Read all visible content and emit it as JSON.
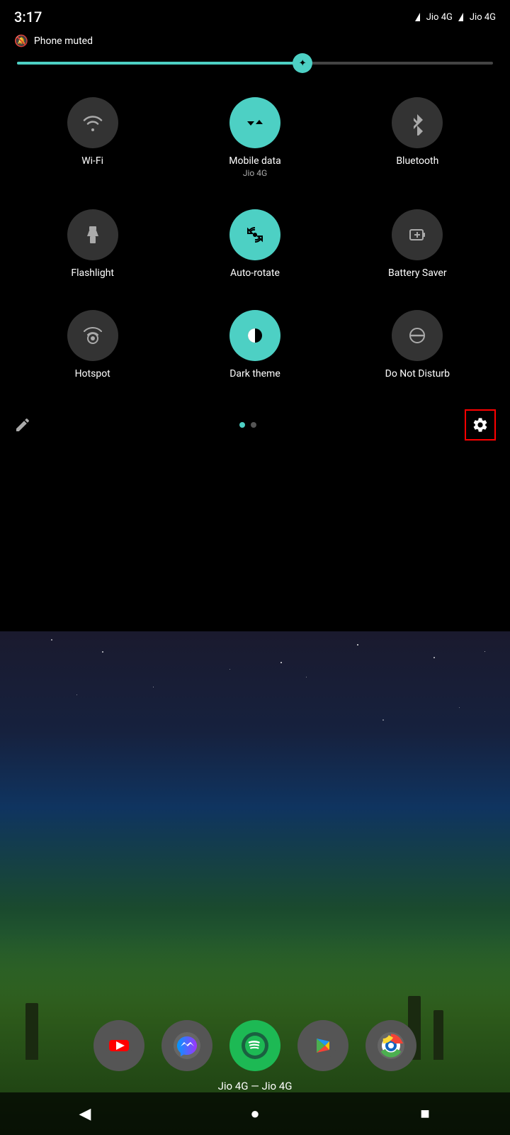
{
  "statusBar": {
    "time": "3:17",
    "phoneMuted": "Phone muted",
    "carrier1": "Jio 4G",
    "carrier2": "Jio 4G"
  },
  "brightness": {
    "percentage": 60
  },
  "tiles": [
    {
      "id": "wifi",
      "label": "Wi-Fi",
      "sublabel": "",
      "active": false,
      "icon": "wifi"
    },
    {
      "id": "mobile-data",
      "label": "Mobile data",
      "sublabel": "Jio 4G",
      "active": true,
      "icon": "mobile-data"
    },
    {
      "id": "bluetooth",
      "label": "Bluetooth",
      "sublabel": "",
      "active": false,
      "icon": "bluetooth"
    },
    {
      "id": "flashlight",
      "label": "Flashlight",
      "sublabel": "",
      "active": false,
      "icon": "flashlight"
    },
    {
      "id": "auto-rotate",
      "label": "Auto-rotate",
      "sublabel": "",
      "active": true,
      "icon": "auto-rotate"
    },
    {
      "id": "battery-saver",
      "label": "Battery Saver",
      "sublabel": "",
      "active": false,
      "icon": "battery-saver"
    },
    {
      "id": "hotspot",
      "label": "Hotspot",
      "sublabel": "",
      "active": false,
      "icon": "hotspot"
    },
    {
      "id": "dark-theme",
      "label": "Dark theme",
      "sublabel": "",
      "active": true,
      "icon": "dark-theme"
    },
    {
      "id": "do-not-disturb",
      "label": "Do Not Disturb",
      "sublabel": "",
      "active": false,
      "icon": "dnd"
    }
  ],
  "qsBottom": {
    "editLabel": "edit",
    "settingsLabel": "settings"
  },
  "dock": {
    "apps": [
      {
        "id": "youtube",
        "label": ""
      },
      {
        "id": "messenger",
        "label": ""
      },
      {
        "id": "spotify",
        "label": ""
      },
      {
        "id": "play",
        "label": ""
      },
      {
        "id": "chrome",
        "label": ""
      }
    ],
    "carrierLabel": "Jio 4G — Jio 4G"
  },
  "navBar": {
    "back": "◀",
    "home": "●",
    "recents": "■"
  }
}
